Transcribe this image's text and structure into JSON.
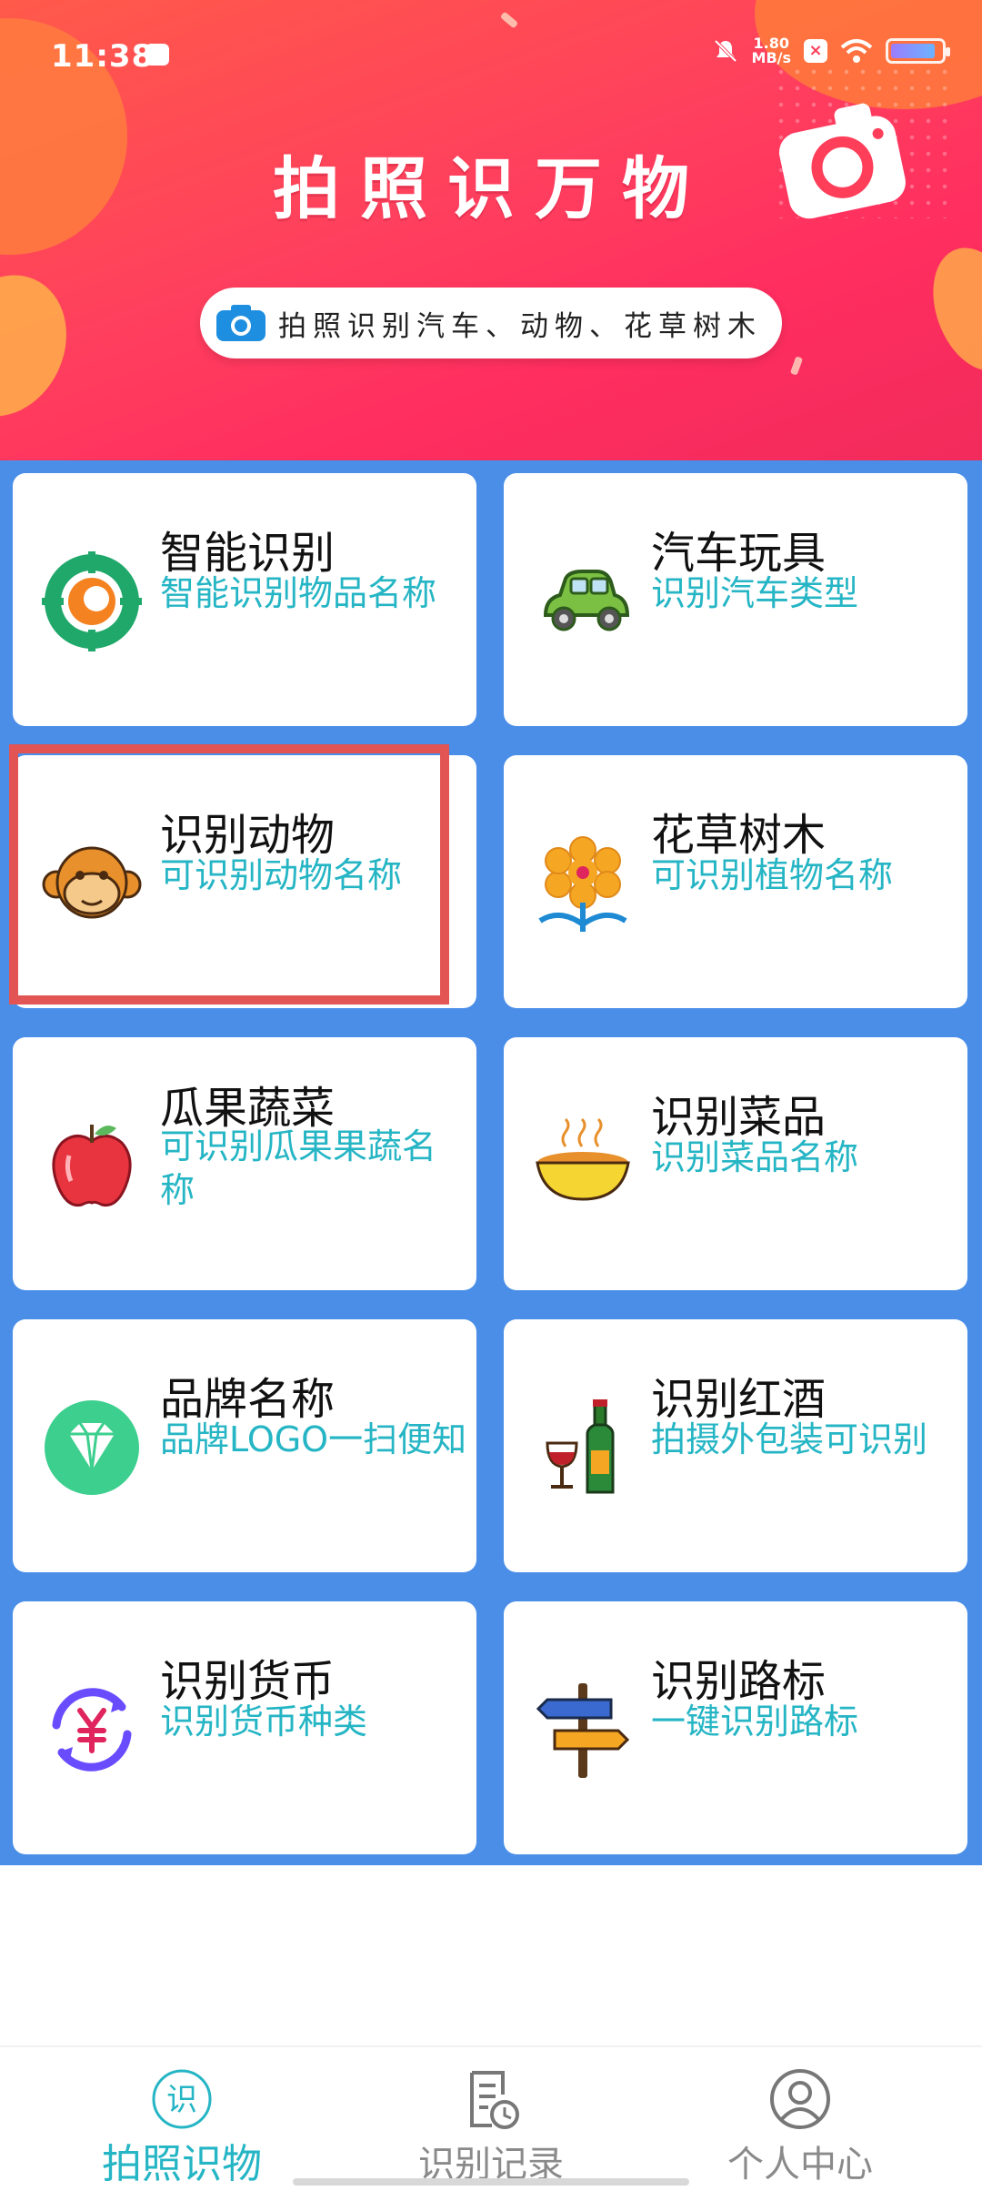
{
  "status_bar": {
    "time": "11:38",
    "net_speed_value": "1.80",
    "net_speed_unit": "MB/s"
  },
  "banner": {
    "title": "拍照识万物",
    "pill_text": "拍照识别汽车、动物、花草树木"
  },
  "colors": {
    "grid_background": "#4a8ee8",
    "subtitle": "#25b5c4",
    "highlight_border": "#e25554",
    "active_nav": "#25b5c4"
  },
  "cards": [
    {
      "title": "智能识别",
      "subtitle": "智能识别物品名称",
      "icon": "target-icon"
    },
    {
      "title": "汽车玩具",
      "subtitle": "识别汽车类型",
      "icon": "car-icon"
    },
    {
      "title": "识别动物",
      "subtitle": "可识别动物名称",
      "icon": "monkey-icon"
    },
    {
      "title": "花草树木",
      "subtitle": "可识别植物名称",
      "icon": "flower-icon"
    },
    {
      "title": "瓜果蔬菜",
      "subtitle": "可识别瓜果果蔬名称",
      "icon": "apple-icon"
    },
    {
      "title": "识别菜品",
      "subtitle": "识别菜品名称",
      "icon": "dish-icon"
    },
    {
      "title": "品牌名称",
      "subtitle": "品牌LOGO一扫便知",
      "icon": "diamond-icon"
    },
    {
      "title": "识别红酒",
      "subtitle": "拍摄外包装可识别",
      "icon": "wine-icon"
    },
    {
      "title": "识别货币",
      "subtitle": "识别货币种类",
      "icon": "currency-icon"
    },
    {
      "title": "识别路标",
      "subtitle": "一键识别路标",
      "icon": "signpost-icon"
    }
  ],
  "bottom_nav": {
    "items": [
      {
        "label": "拍照识物",
        "icon_text": "识",
        "active": true
      },
      {
        "label": "识别记录",
        "active": false
      },
      {
        "label": "个人中心",
        "active": false
      }
    ]
  }
}
